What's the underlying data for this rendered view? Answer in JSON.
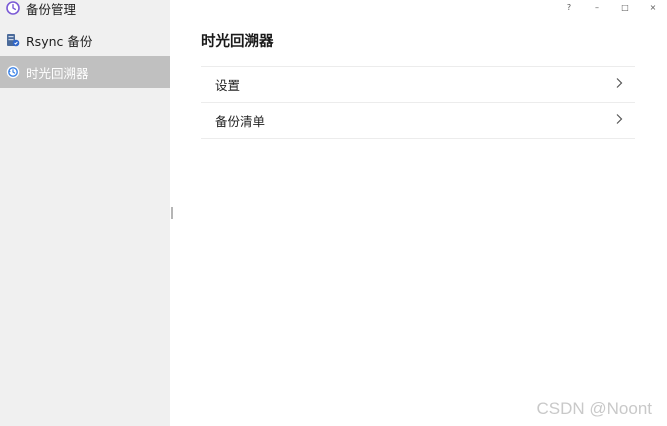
{
  "window": {
    "controls": {
      "help": "?",
      "minimize": "–",
      "maximize": "□",
      "close": "×"
    }
  },
  "sidebar": {
    "items": [
      {
        "label": "备份管理",
        "icon": "clock-icon",
        "active": false
      },
      {
        "label": "Rsync 备份",
        "icon": "server-backup-icon",
        "active": false
      },
      {
        "label": "时光回溯器",
        "icon": "time-machine-icon",
        "active": true
      }
    ]
  },
  "main": {
    "title": "时光回溯器",
    "list": [
      {
        "label": "设置"
      },
      {
        "label": "备份清单"
      }
    ]
  },
  "watermark": "CSDN @Noont",
  "colors": {
    "sidebar_bg": "#f0f0f0",
    "active_bg": "#c0c0c0",
    "accent_purple": "#7b5bd6",
    "accent_blue": "#3b82e6"
  }
}
